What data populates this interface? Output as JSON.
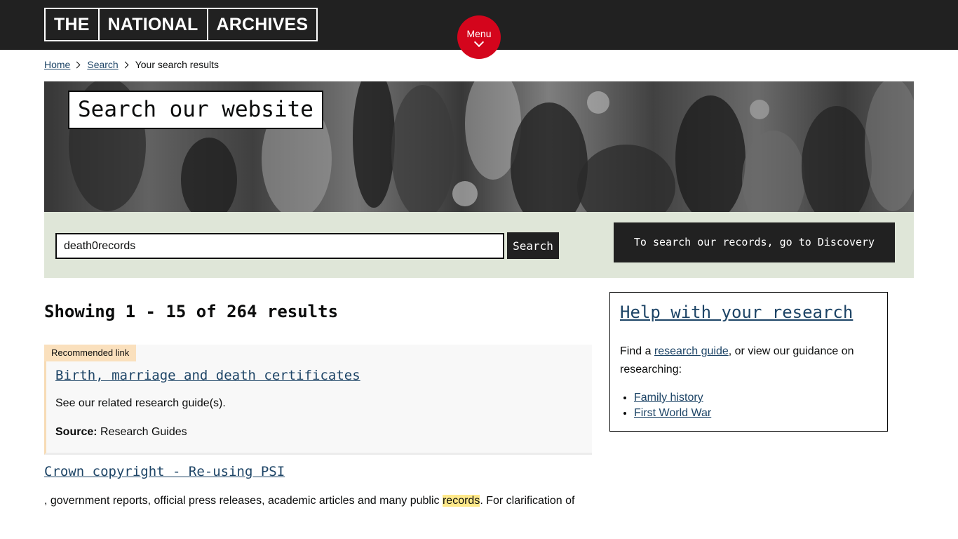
{
  "header": {
    "logo_words": [
      "THE",
      "NATIONAL",
      "ARCHIVES"
    ],
    "menu_label": "Menu"
  },
  "breadcrumb": {
    "home": "Home",
    "search": "Search",
    "current": "Your search results"
  },
  "hero": {
    "title": "Search our website"
  },
  "search": {
    "query": "death0records",
    "button_label": "Search",
    "discovery_label": "To search our records, go to Discovery"
  },
  "results": {
    "count_text": "Showing 1 - 15 of 264 results",
    "recommended": {
      "tag": "Recommended link",
      "title": "Birth, marriage and death certificates",
      "description": "See our related research guide(s).",
      "source_label": "Source:",
      "source_value": "Research Guides"
    },
    "items": [
      {
        "title": "Crown copyright - Re-using PSI",
        "snippet_before": ", government reports, official press releases, academic articles and many public ",
        "snippet_highlight": "records",
        "snippet_after": ". For clarification of"
      }
    ]
  },
  "help": {
    "title": "Help with your research",
    "text_before": "Find a ",
    "text_link": "research guide",
    "text_after": ", or view our guidance on researching:",
    "links": [
      "Family history",
      "First World War"
    ]
  },
  "colors": {
    "header_bg": "#212121",
    "menu_red": "#d4051c",
    "link_blue": "#1d4466",
    "search_band": "#dfe6d8",
    "highlight": "#ffe98a"
  }
}
